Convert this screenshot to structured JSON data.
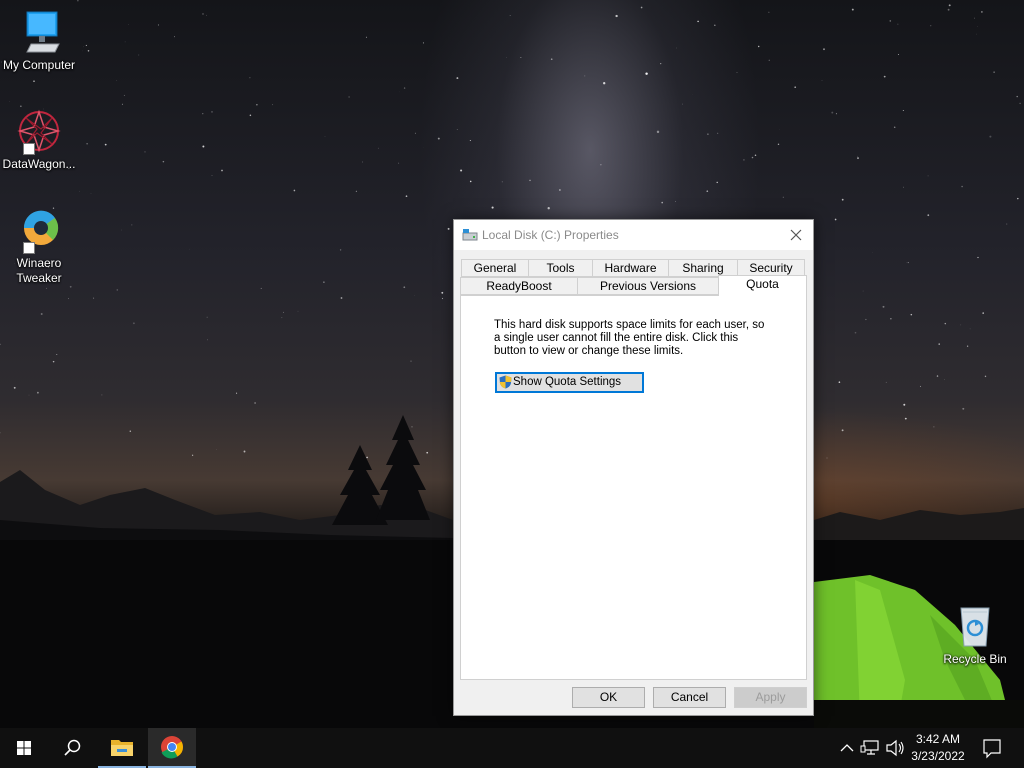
{
  "desktop": {
    "icons": [
      {
        "label": "My Computer",
        "icon": "monitor-icon"
      },
      {
        "label": "DataWagon...",
        "icon": "datawagon-icon",
        "shortcut": true
      },
      {
        "label": "Winaero Tweaker",
        "icon": "winaero-icon",
        "shortcut": true
      },
      {
        "label": "Recycle Bin",
        "icon": "recycle-bin-icon"
      }
    ]
  },
  "dialog": {
    "title": "Local Disk (C:) Properties",
    "tabs_row1": [
      "General",
      "Tools",
      "Hardware",
      "Sharing",
      "Security"
    ],
    "tabs_row2": [
      "ReadyBoost",
      "Previous Versions",
      "Quota"
    ],
    "active_tab": "Quota",
    "description": "This hard disk supports space limits for each user, so a single user cannot fill the entire disk. Click this button to view or change these limits.",
    "quota_button": "Show Quota Settings",
    "ok": "OK",
    "cancel": "Cancel",
    "apply": "Apply"
  },
  "taskbar": {
    "time": "3:42 AM",
    "date": "3/23/2022",
    "pinned": [
      "start-icon",
      "search-icon",
      "file-explorer-icon",
      "chrome-icon"
    ]
  },
  "colors": {
    "accent": "#0078d7",
    "taskbar": "#101010",
    "tent": "#7fd42a"
  }
}
